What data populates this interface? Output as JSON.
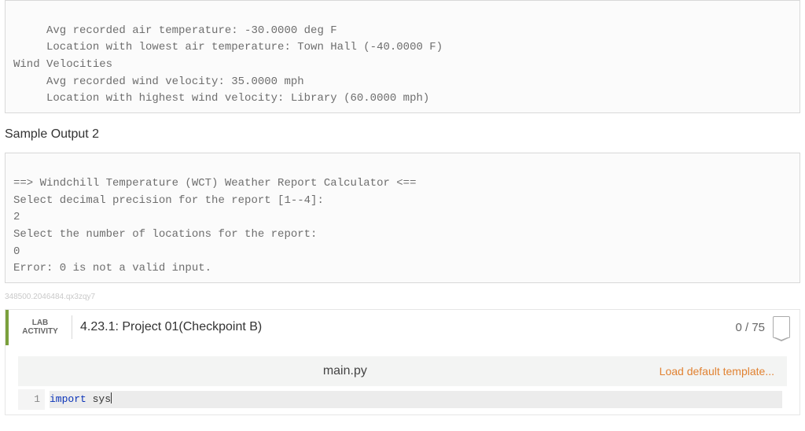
{
  "output_block_1": {
    "lines": [
      "     Avg recorded air temperature: -30.0000 deg F",
      "     Location with lowest air temperature: Town Hall (-40.0000 F)",
      "Wind Velocities",
      "     Avg recorded wind velocity: 35.0000 mph",
      "     Location with highest wind velocity: Library (60.0000 mph)"
    ]
  },
  "sample_heading_2": "Sample Output 2",
  "output_block_2": {
    "lines": [
      "==> Windchill Temperature (WCT) Weather Report Calculator <==",
      "Select decimal precision for the report [1--4]:",
      "2",
      "Select the number of locations for the report:",
      "0",
      "Error: 0 is not a valid input."
    ]
  },
  "hash_text": "348500.2046484.qx3zqy7",
  "lab": {
    "lab_label_top": "LAB",
    "lab_label_bottom": "ACTIVITY",
    "title": "4.23.1: Project 01(Checkpoint B)",
    "score": "0 / 75",
    "file_name": "main.py",
    "load_link": "Load default template...",
    "line_number": "1",
    "keyword": "import",
    "module": " sys"
  }
}
